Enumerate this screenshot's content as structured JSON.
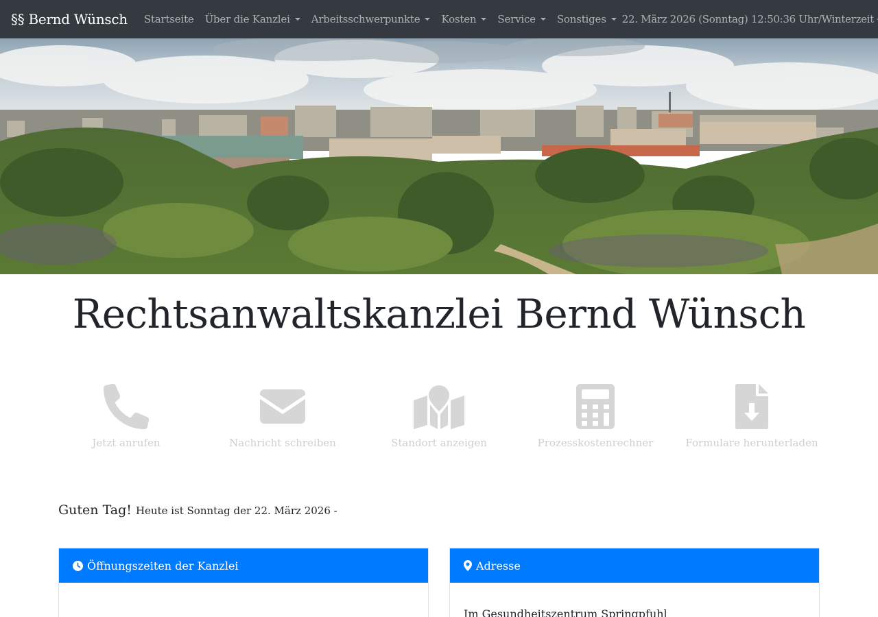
{
  "navbar": {
    "brand": "§§ Bernd Wünsch",
    "items": [
      {
        "label": "Startseite",
        "dropdown": false
      },
      {
        "label": "Über die Kanzlei",
        "dropdown": true
      },
      {
        "label": "Arbeitsschwerpunkte",
        "dropdown": true
      },
      {
        "label": "Kosten",
        "dropdown": true
      },
      {
        "label": "Service",
        "dropdown": true
      },
      {
        "label": "Sonstiges",
        "dropdown": true
      }
    ],
    "clock": "22. März 2026 (Sonntag) 12:50:36 Uhr/Winterzeit",
    "clock_icon": "sun-icon"
  },
  "hero": {
    "image": "panorama-cityscape-with-green-hill"
  },
  "title": "Rechtsanwaltskanzlei Bernd Wünsch",
  "actions": [
    {
      "icon": "phone-icon",
      "label": "Jetzt anrufen"
    },
    {
      "icon": "envelope-icon",
      "label": "Nachricht schreiben"
    },
    {
      "icon": "map-icon",
      "label": "Standort anzeigen"
    },
    {
      "icon": "calculator-icon",
      "label": "Prozesskostenrechner"
    },
    {
      "icon": "file-download-icon",
      "label": "Formulare herunterladen"
    }
  ],
  "greeting": {
    "hello": "Guten Tag!",
    "today": "Heute ist Sonntag der 22. März 2026 -"
  },
  "cards": {
    "hours": {
      "icon": "clock-icon",
      "title": "Öffnungszeiten der Kanzlei",
      "body": ""
    },
    "address": {
      "icon": "map-marker-icon",
      "title": "Adresse",
      "body": "Im Gesundheitszentrum Springpfuhl"
    }
  },
  "colors": {
    "navbar_bg": "#343a40",
    "card_header": "#007bff",
    "icon_gray": "#d6d6d6"
  }
}
